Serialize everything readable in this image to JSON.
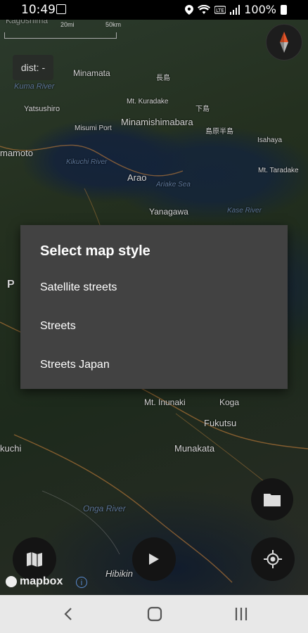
{
  "status_bar": {
    "time": "10:49",
    "battery": "100%"
  },
  "map": {
    "scale_labels": [
      "20mi",
      "50km"
    ],
    "dist_label": "dist: -",
    "place_labels": [
      "Kagoshima",
      "Minamata",
      "Mt. Kuradake",
      "Minamishimabara",
      "Misumi Port",
      "Yatsushiro",
      "mamoto",
      "Arao",
      "Yanagawa",
      "Isahaya",
      "Mt. Taradake",
      "Mt. Inunaki",
      "Koga",
      "Fukutsu",
      "Munakata",
      "kuchi",
      "Hibikin"
    ],
    "water_labels": [
      "Kuma River",
      "Kikuchi River",
      "Ariake Sea",
      "Kase River",
      "Onga River"
    ],
    "japanese_labels": [
      "長島",
      "下島",
      "島原半島"
    ],
    "attribution": "mapbox"
  },
  "dialog": {
    "title": "Select map style",
    "options": [
      "Satellite streets",
      "Streets",
      "Streets Japan"
    ]
  },
  "buttons": {
    "folder": "folder-icon",
    "map": "map-icon",
    "play": "play-icon",
    "locate": "my-location-icon",
    "compass": "compass-icon"
  },
  "colors": {
    "dialog_bg": "#424242",
    "nav_bg": "#e8e8e8",
    "info_accent": "#5b8cd2",
    "compass_needle": "#e8562a"
  }
}
